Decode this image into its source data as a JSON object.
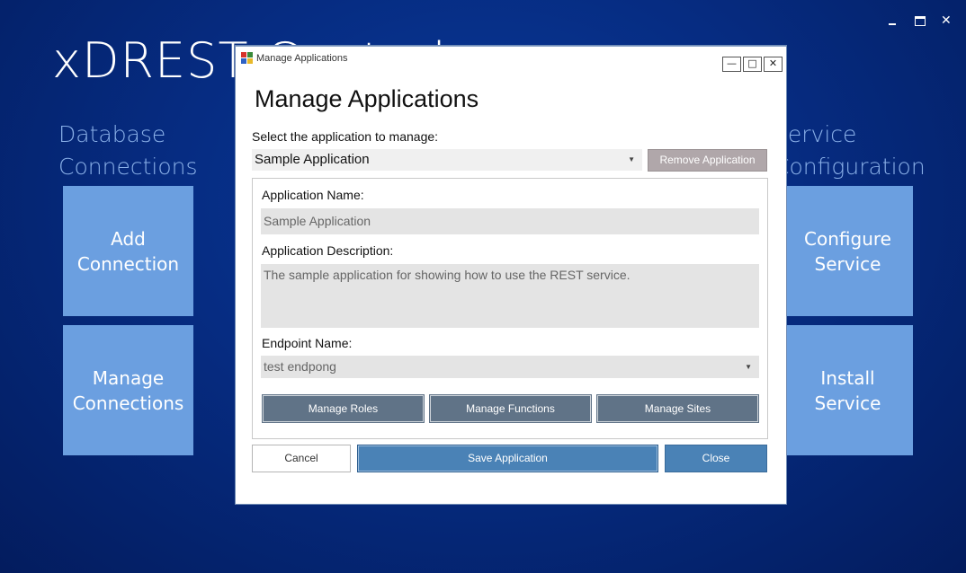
{
  "background_app": {
    "title": "xDREST Control",
    "window_controls": {
      "minimize": "",
      "maximize": "",
      "close": "✕"
    },
    "sections": {
      "database": {
        "label_line1": "Database",
        "label_line2": "Connections"
      },
      "service": {
        "label_line1": "Service",
        "label_line2": "Configuration"
      }
    },
    "tiles": {
      "add_connection": {
        "line1": "Add",
        "line2": "Connection"
      },
      "manage_connections": {
        "line1": "Manage",
        "line2": "Connections"
      },
      "configure_service": {
        "line1": "Configure",
        "line2": "Service"
      },
      "install_service": {
        "line1": "Install",
        "line2": "Service"
      }
    }
  },
  "dialog": {
    "window_title": "Manage Applications",
    "controls": {
      "minimize": "—",
      "maximize": "□",
      "close": "✕"
    },
    "heading": "Manage Applications",
    "select_label": "Select the application to manage:",
    "selected_application": "Sample Application",
    "remove_button": "Remove Application",
    "form": {
      "name_label": "Application Name:",
      "name_value": "Sample Application",
      "description_label": "Application Description:",
      "description_value": "The sample application for showing how to use the REST service.",
      "endpoint_label": "Endpoint Name:",
      "endpoint_value": "test endpong",
      "buttons": {
        "manage_roles": "Manage Roles",
        "manage_functions": "Manage Functions",
        "manage_sites": "Manage Sites"
      }
    },
    "footer": {
      "cancel": "Cancel",
      "save": "Save Application",
      "close": "Close"
    }
  },
  "colors": {
    "background": "#062c82",
    "tile": "#6b9fe0",
    "section_label": "#8ab0e8",
    "primary_button": "#4a82b6",
    "secondary_button": "#607387",
    "disabled_button": "#b0a7aa"
  }
}
